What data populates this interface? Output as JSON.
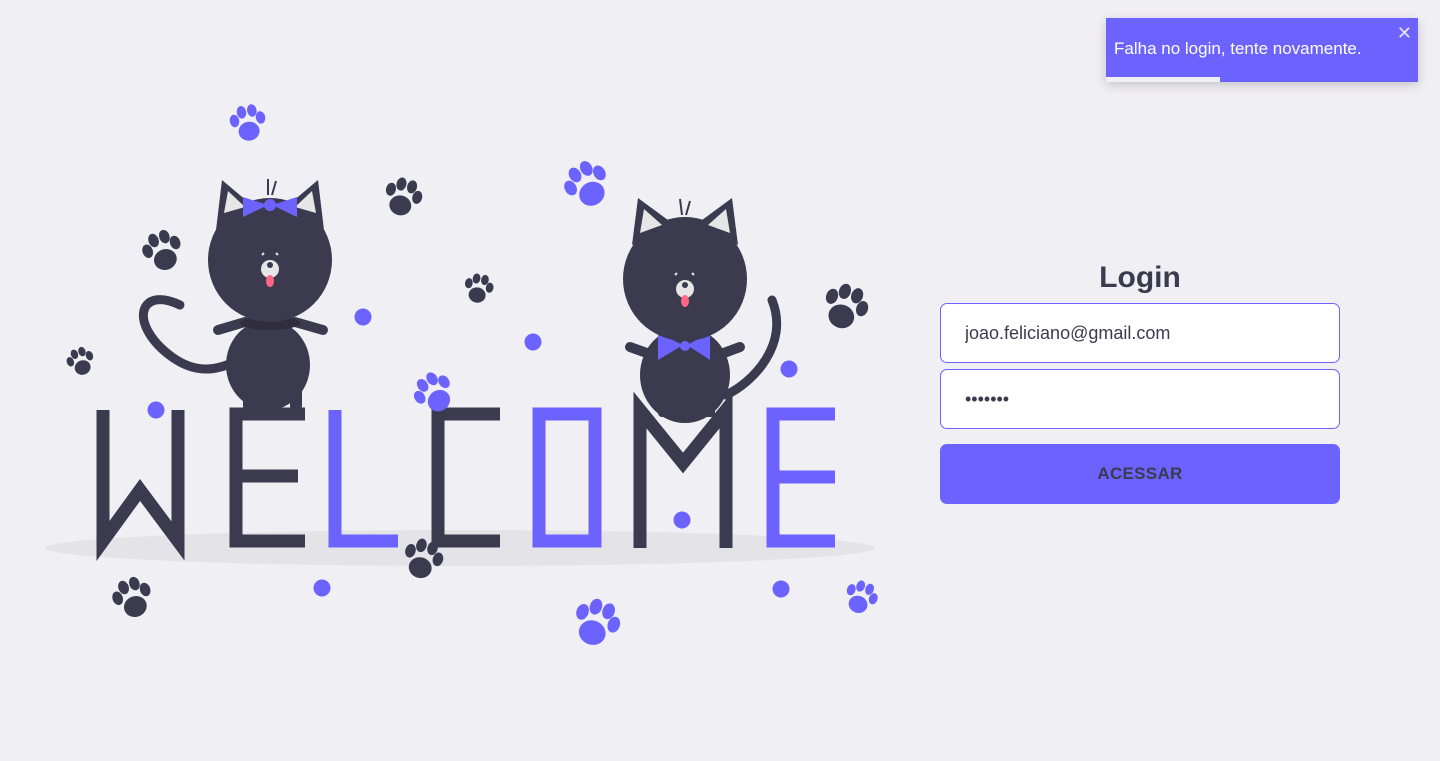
{
  "colors": {
    "background": "#f0eff4",
    "accent": "#6c63ff",
    "dark": "#3c3a4e",
    "white": "#ffffff"
  },
  "illustration": {
    "letters": [
      "W",
      "E",
      "L",
      "C",
      "O",
      "M",
      "E"
    ],
    "accent_letters": [
      "L",
      "O",
      "E"
    ]
  },
  "login": {
    "title": "Login",
    "email": {
      "value": "joao.feliciano@gmail.com",
      "placeholder": ""
    },
    "password": {
      "value": "1234567",
      "placeholder": ""
    },
    "submit_label": "ACESSAR"
  },
  "toast": {
    "message": "Falha no login, tente novamente.",
    "close_icon": "close-icon",
    "progress": 0.365
  }
}
